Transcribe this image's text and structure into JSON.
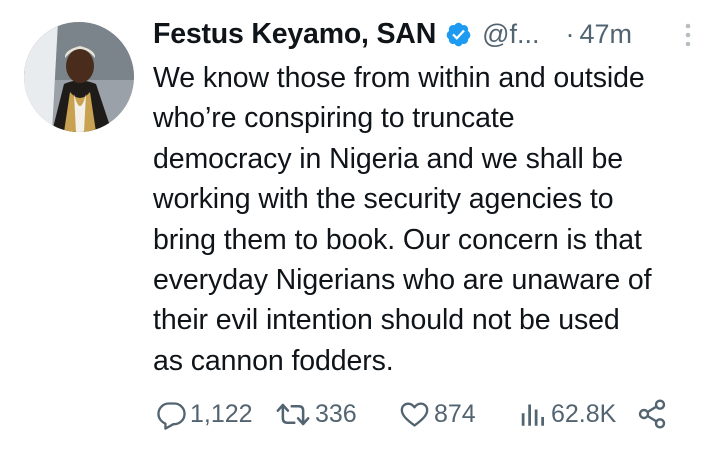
{
  "author": {
    "name": "Festus Keyamo, SAN",
    "handle": "@f...",
    "time": "47m",
    "time_separator": "·"
  },
  "tweet": {
    "lines": [
      "We know those from within and outside",
      "who’re conspiring to truncate",
      "democracy in Nigeria and we shall be",
      "working with the security agencies to",
      "bring them to book. Our concern is that",
      "everyday Nigerians who are unaware of",
      "their evil intention should not be used",
      "as cannon fodders."
    ]
  },
  "stats": {
    "replies": "1,122",
    "reposts": "336",
    "likes": "874",
    "views": "62.8K"
  },
  "icons": {
    "verified": "verified-badge-icon",
    "more": "more-vertical-icon",
    "reply": "reply-icon",
    "repost": "repost-icon",
    "like": "heart-icon",
    "views": "views-bar-chart-icon",
    "share": "share-icon"
  },
  "colors": {
    "verified_blue": "#1d9bf0",
    "text_primary": "#0f1419",
    "text_secondary": "#536471"
  }
}
